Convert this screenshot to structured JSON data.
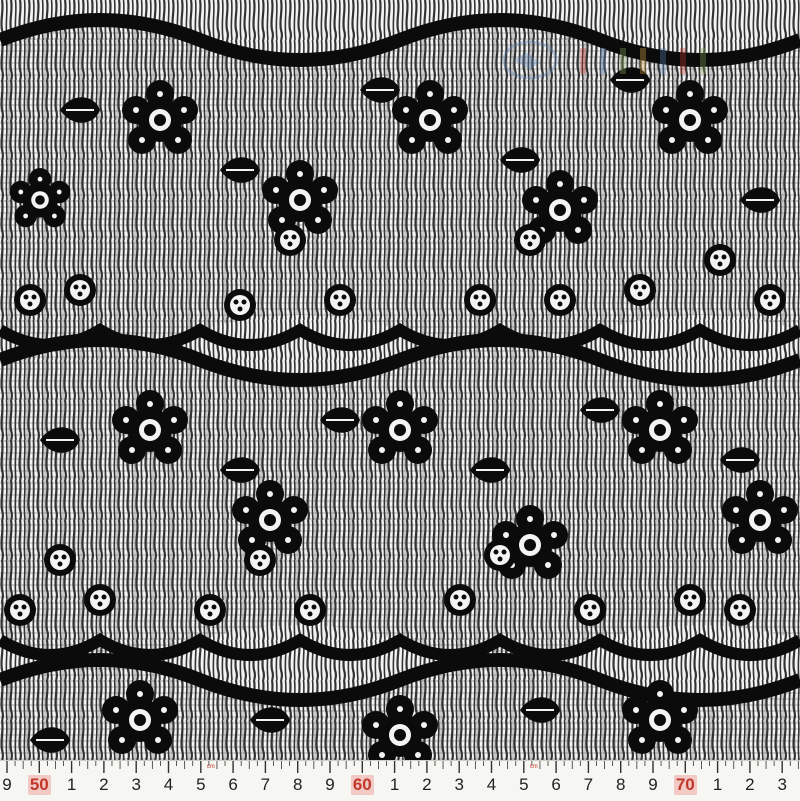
{
  "image": {
    "subject": "Black lace fabric with scalloped floral bands on white background",
    "colors": {
      "lace": "#0b0b0b",
      "background": "#f4f4f4",
      "ruler": "#f6f6f2",
      "ruler_accent": "#c0392b"
    }
  },
  "ruler": {
    "labels": [
      "9",
      "50",
      "1",
      "2",
      "3",
      "4",
      "5",
      "6",
      "7",
      "8",
      "9",
      "60",
      "1",
      "2",
      "3",
      "4",
      "5",
      "6",
      "7",
      "8",
      "9",
      "70",
      "1",
      "2",
      "3"
    ],
    "major_labels": [
      "50",
      "60",
      "70"
    ],
    "unit_mark": "cm"
  },
  "watermark": {
    "icon": "logo-icon"
  }
}
